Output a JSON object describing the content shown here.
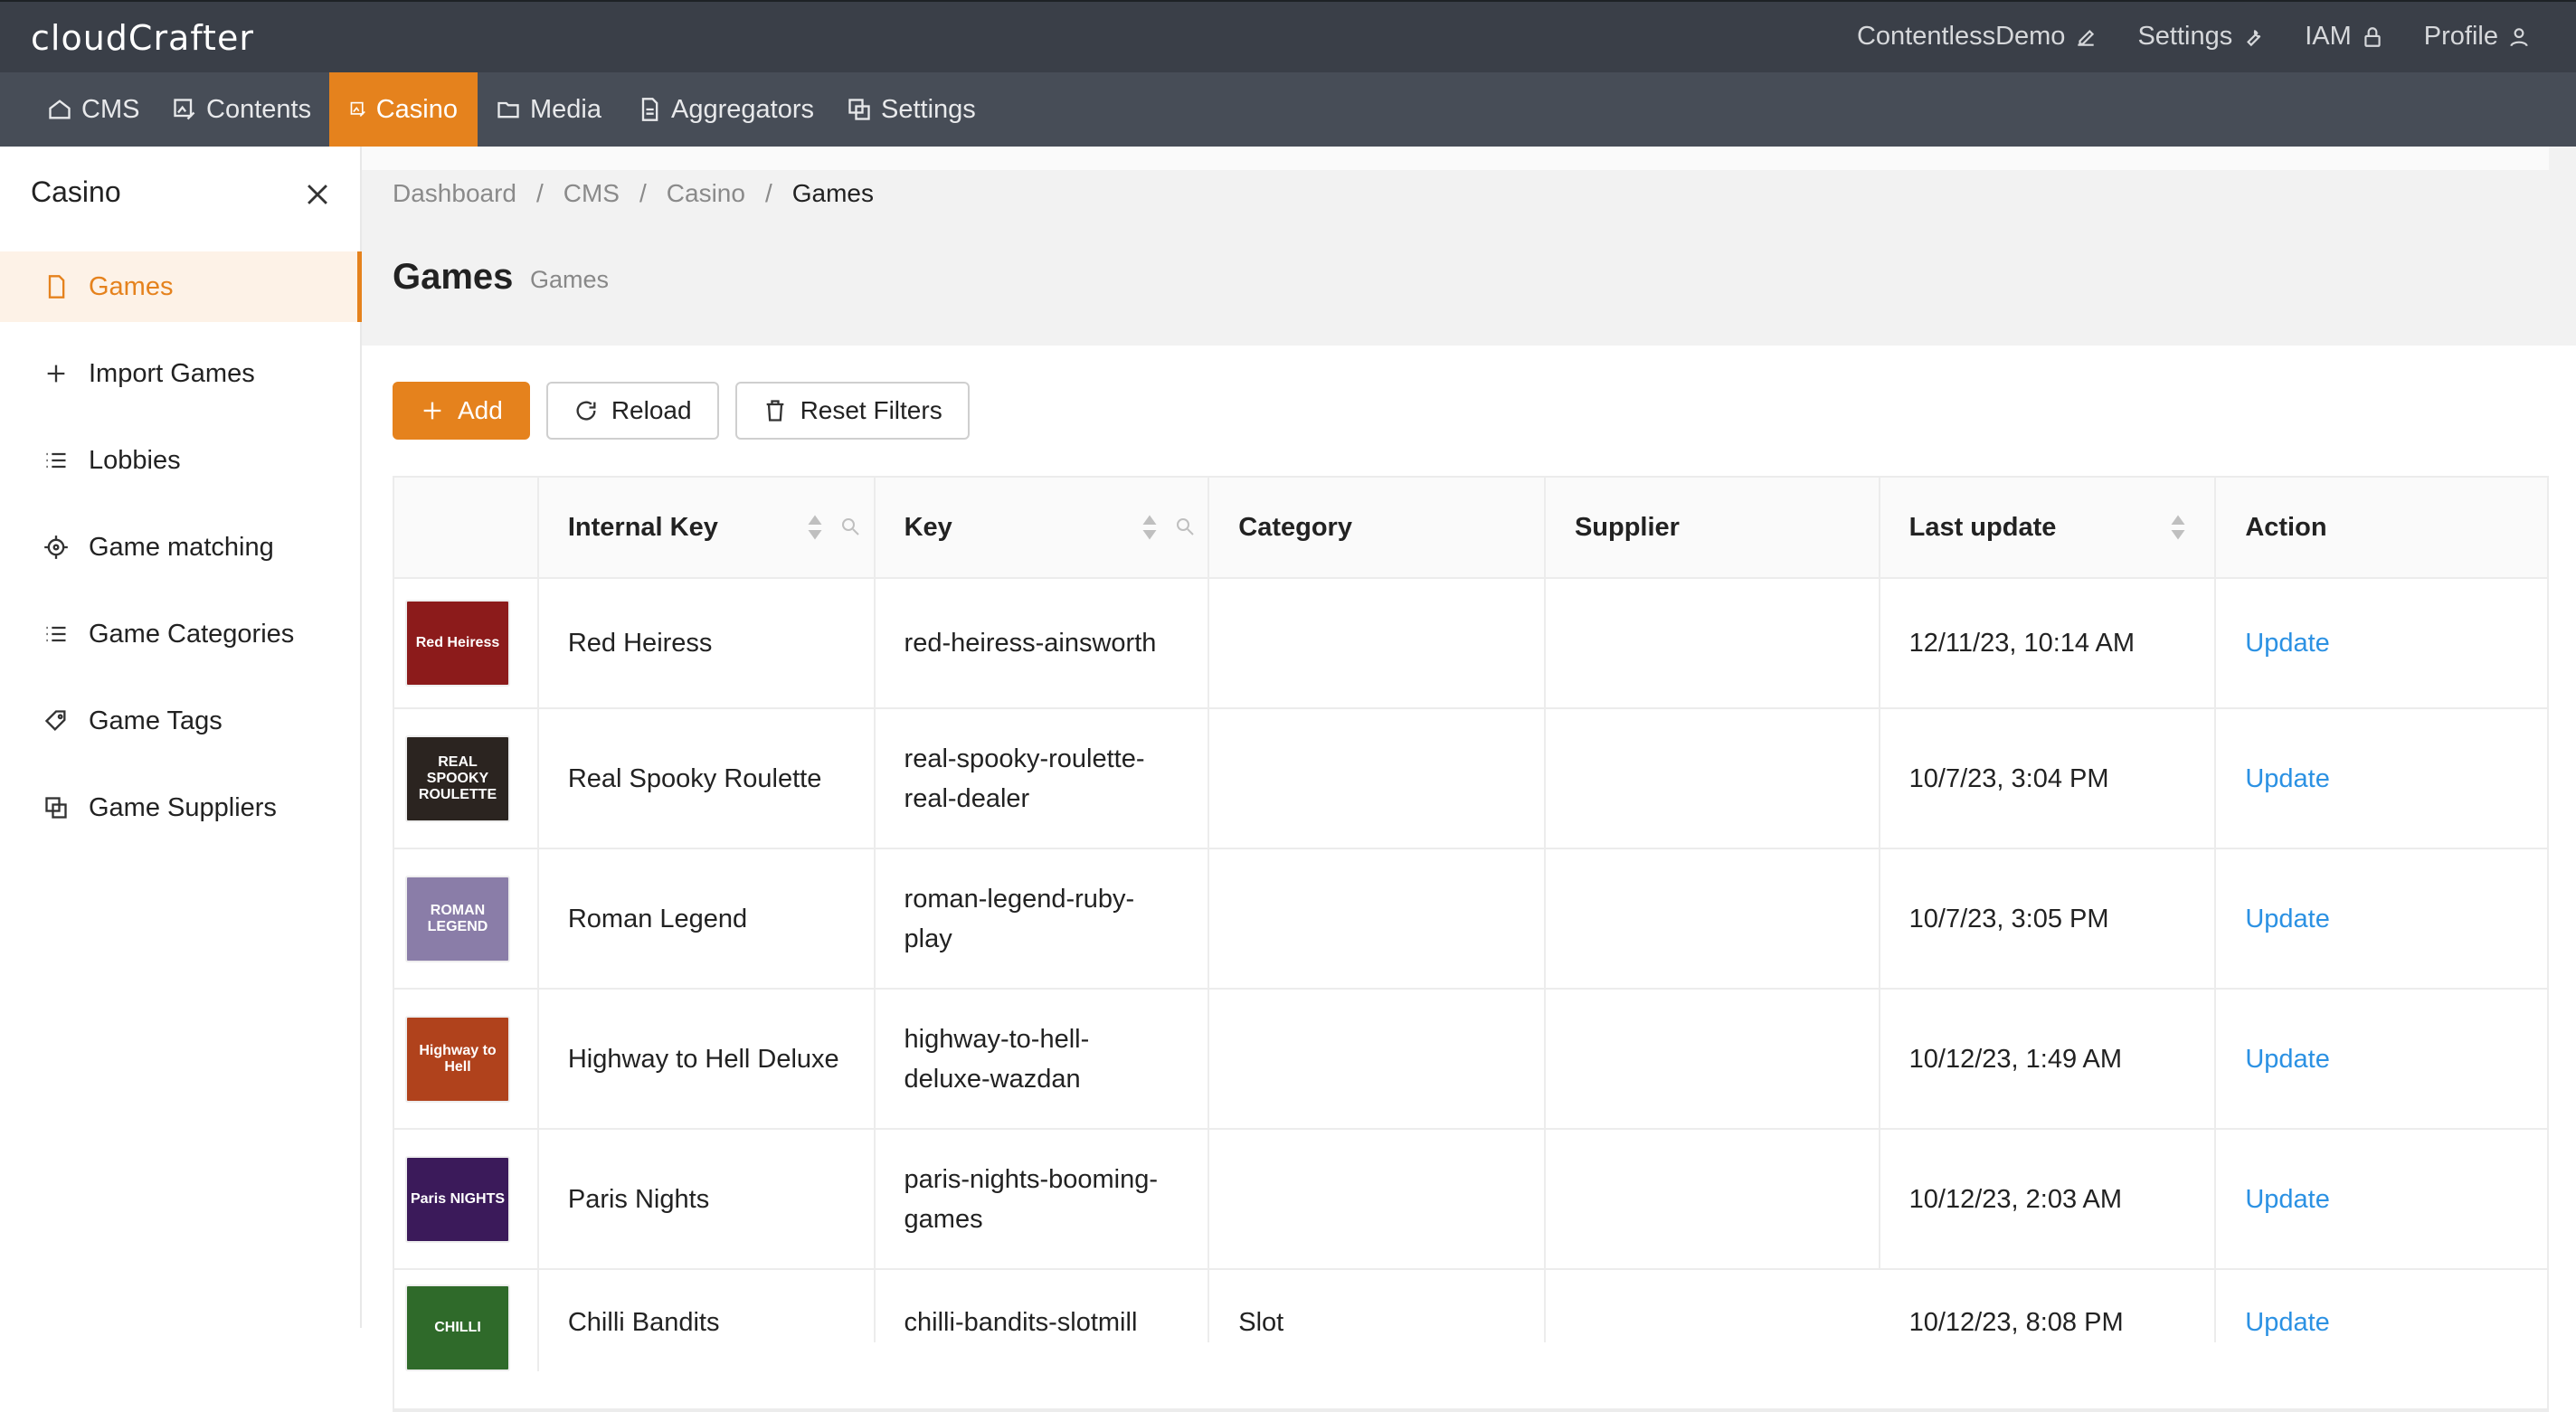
{
  "app": {
    "logo": "cloudCrafter"
  },
  "top_links": [
    {
      "label": "ContentlessDemo",
      "icon": "edit-icon"
    },
    {
      "label": "Settings",
      "icon": "wrench-icon"
    },
    {
      "label": "IAM",
      "icon": "lock-icon"
    },
    {
      "label": "Profile",
      "icon": "user-icon"
    }
  ],
  "nav": [
    {
      "label": "CMS",
      "icon": "home-icon"
    },
    {
      "label": "Contents",
      "icon": "image-edit-icon"
    },
    {
      "label": "Casino",
      "icon": "image-edit-icon",
      "active": true
    },
    {
      "label": "Media",
      "icon": "folder-icon"
    },
    {
      "label": "Aggregators",
      "icon": "file-icon"
    },
    {
      "label": "Settings",
      "icon": "block-icon"
    }
  ],
  "sidebar": {
    "title": "Casino",
    "items": [
      {
        "label": "Games",
        "icon": "file-icon",
        "active": true
      },
      {
        "label": "Import Games",
        "icon": "plus-icon"
      },
      {
        "label": "Lobbies",
        "icon": "list-icon"
      },
      {
        "label": "Game matching",
        "icon": "aim-icon"
      },
      {
        "label": "Game Categories",
        "icon": "list-icon"
      },
      {
        "label": "Game Tags",
        "icon": "tag-icon"
      },
      {
        "label": "Game Suppliers",
        "icon": "block-icon"
      }
    ]
  },
  "breadcrumb": [
    "Dashboard",
    "CMS",
    "Casino",
    "Games"
  ],
  "page": {
    "title": "Games",
    "subtitle": "Games"
  },
  "toolbar": {
    "add": "Add",
    "reload": "Reload",
    "reset": "Reset Filters"
  },
  "table": {
    "columns": [
      "",
      "Internal Key",
      "Key",
      "Category",
      "Supplier",
      "Last update",
      "Action"
    ],
    "rows": [
      {
        "thumb": "Red Heiress",
        "thumb_color": "#8c1b1b",
        "internal_key": "Red Heiress",
        "key": "red-heiress-ainsworth",
        "category": "",
        "supplier": "",
        "last_update": "12/11/23, 10:14 AM",
        "action": "Update"
      },
      {
        "thumb": "REAL SPOOKY ROULETTE",
        "thumb_color": "#2b2420",
        "internal_key": "Real Spooky Roulette",
        "key": "real-spooky-roulette-real-dealer",
        "category": "",
        "supplier": "",
        "last_update": "10/7/23, 3:04 PM",
        "action": "Update"
      },
      {
        "thumb": "ROMAN LEGEND",
        "thumb_color": "#8a7da8",
        "internal_key": "Roman Legend",
        "key": "roman-legend-ruby-play",
        "category": "",
        "supplier": "",
        "last_update": "10/7/23, 3:05 PM",
        "action": "Update"
      },
      {
        "thumb": "Highway to Hell",
        "thumb_color": "#b0421c",
        "internal_key": "Highway to Hell Deluxe",
        "key": "highway-to-hell-deluxe-wazdan",
        "category": "",
        "supplier": "",
        "last_update": "10/12/23, 1:49 AM",
        "action": "Update"
      },
      {
        "thumb": "Paris NIGHTS",
        "thumb_color": "#3b1a5a",
        "internal_key": "Paris Nights",
        "key": "paris-nights-booming-games",
        "category": "",
        "supplier": "",
        "last_update": "10/12/23, 2:03 AM",
        "action": "Update"
      },
      {
        "thumb": "CHILLI",
        "thumb_color": "#2f6a2a",
        "internal_key": "Chilli Bandits",
        "key": "chilli-bandits-slotmill",
        "category": "Slot",
        "supplier": "",
        "last_update": "10/12/23, 8:08 PM",
        "action": "Update"
      }
    ]
  }
}
